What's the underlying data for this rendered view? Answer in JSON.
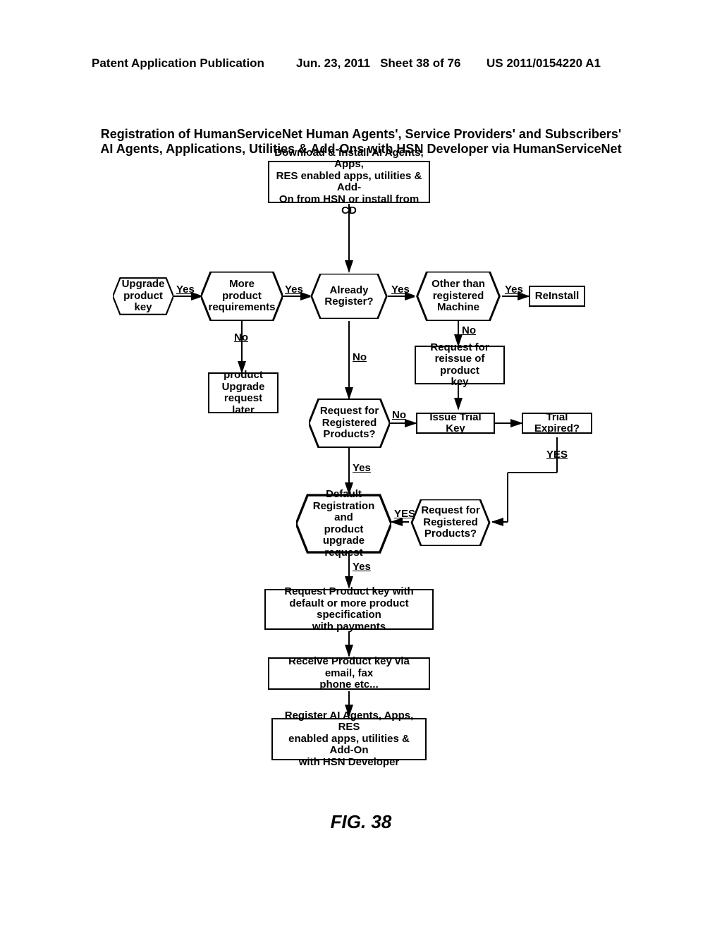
{
  "header": {
    "left": "Patent Application Publication",
    "mid": "Jun. 23, 2011",
    "sheet": "Sheet 38 of 76",
    "right": "US 2011/0154220 A1"
  },
  "title": {
    "l1": "Registration of HumanServiceNet Human Agents', Service Providers' and Subscribers'",
    "l2": "AI Agents, Applications, Utilities & Add-Ons with HSN Developer via HumanServiceNet"
  },
  "figure_label": "FIG. 38",
  "nodes": {
    "download": "Download & install AI Agents, Apps,\nRES enabled apps, utilities & Add-\nOn from HSN or install from CD",
    "upgrade_key": "Upgrade\nproduct\nkey",
    "more_req": "More\nproduct\nrequirements",
    "already_reg": "Already\nRegister?",
    "other_machine": "Other than\nregistered\nMachine",
    "reinstall": "ReInstall",
    "upgrade_later": "product\nUpgrade\nrequest later",
    "req_reissue": "Request for\nreissue of product\nkey",
    "req_reg_1": "Request for\nRegistered\nProducts?",
    "issue_trial": "Issue Trial Key",
    "trial_expired": "Trial Expired?",
    "default_reg": "Default\nRegistration and\nproduct upgrade\nrequest",
    "req_reg_2": "Request for\nRegistered\nProducts?",
    "req_prod_key": "Request Product key with\ndefault or more product specification\nwith payments",
    "receive_key": "Receive Product key via email, fax\nphone etc...",
    "register": "Register AI Agents, Apps, RES\nenabled apps, utilities & Add-On\nwith HSN Developer"
  },
  "labels": {
    "yes": "Yes",
    "no": "No",
    "YES": "YES"
  }
}
